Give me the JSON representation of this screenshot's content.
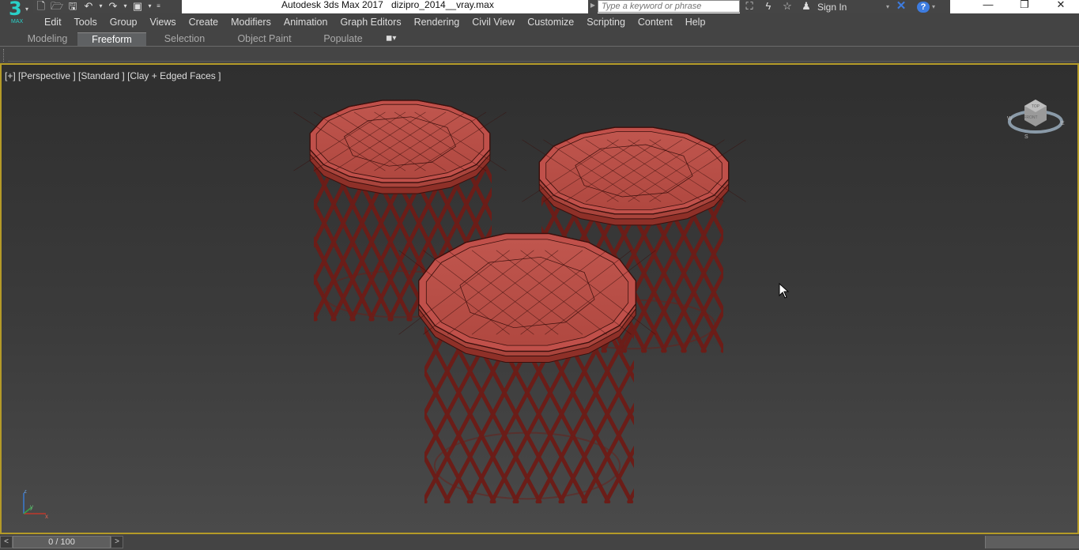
{
  "app": {
    "logo_text": "3",
    "logo_sub": "MAX",
    "title": "Autodesk 3ds Max 2017",
    "file": "dizipro_2014__vray.max"
  },
  "quick_access": [
    {
      "icon": "new-file-icon",
      "glyph": "🗋"
    },
    {
      "icon": "open-folder-icon",
      "glyph": "🗁"
    },
    {
      "icon": "save-icon",
      "glyph": "🖫"
    },
    {
      "icon": "undo-icon",
      "glyph": "↶"
    },
    {
      "icon": "redo-icon",
      "glyph": "↷"
    },
    {
      "icon": "project-folder-icon",
      "glyph": "▣"
    }
  ],
  "search": {
    "placeholder": "Type a keyword or phrase"
  },
  "infocenter": {
    "signin_label": "Sign In",
    "help_glyph": "?",
    "exchange_glyph": "✕"
  },
  "window_controls": {
    "minimize": "—",
    "restore": "❐",
    "close": "✕"
  },
  "menu": [
    "Edit",
    "Tools",
    "Group",
    "Views",
    "Create",
    "Modifiers",
    "Animation",
    "Graph Editors",
    "Rendering",
    "Civil View",
    "Customize",
    "Scripting",
    "Content",
    "Help"
  ],
  "ribbon": {
    "tabs": [
      "Modeling",
      "Freeform",
      "Selection",
      "Object Paint",
      "Populate"
    ],
    "active_tab": "Freeform",
    "dropdown_glyph": "▾"
  },
  "viewport": {
    "label": "[+] [Perspective ] [Standard ] [Clay + Edged Faces ]",
    "model_color": "#c0504a",
    "frame_color": "#6b1d18",
    "border_color": "#b49a28",
    "viewcube": {
      "top": "TOP",
      "front": "FRONT",
      "compass": [
        "N",
        "S",
        "E",
        "W"
      ]
    },
    "axis": {
      "x": "x",
      "y": "y",
      "z": "z"
    }
  },
  "timeline": {
    "frame_label": "0 / 100",
    "prev": "<",
    "next": ">"
  }
}
